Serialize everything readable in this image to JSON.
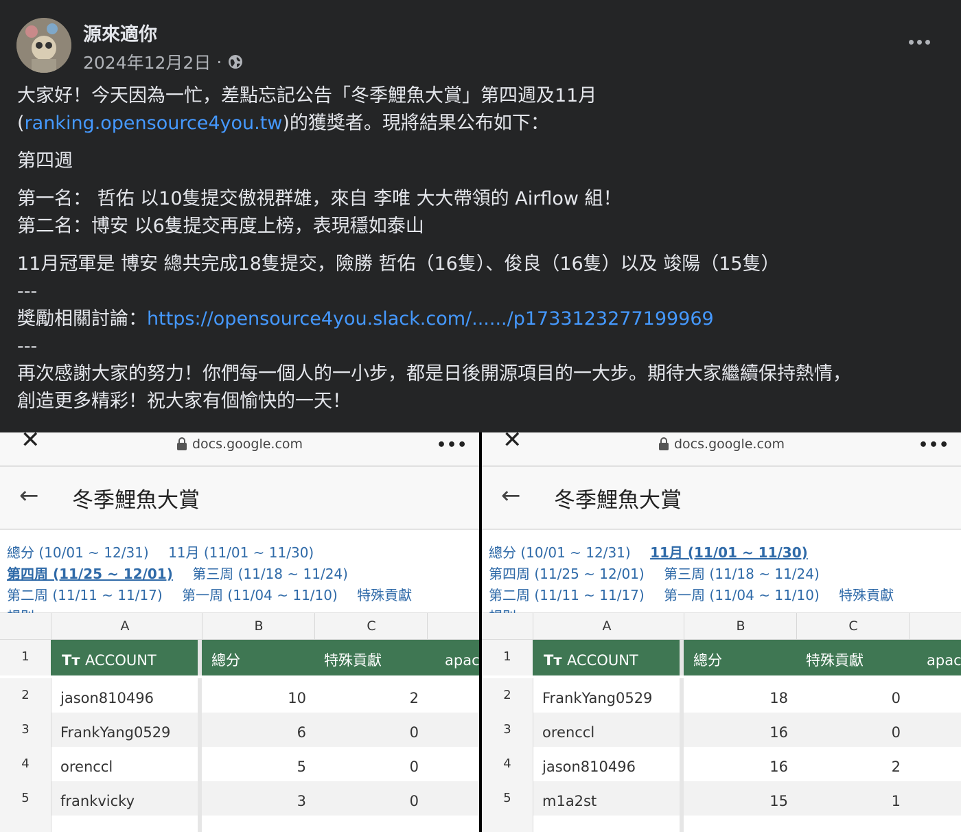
{
  "post": {
    "author": "源來適你",
    "date": "2024年12月2日",
    "date_sep": "·",
    "audience_icon": "globe-icon",
    "menu_icon": "more-horizontal-icon",
    "lines": {
      "p1a": "大家好！今天因為一忙，差點忘記公告「冬季鯉魚大賞」第四週及11月",
      "p1b_pre": "(",
      "p1b_link": "ranking.opensource4you.tw",
      "p1b_post": ")的獲獎者。現將結果公布如下：",
      "p2": "第四週",
      "p3": "第一名： 哲佑 以10隻提交傲視群雄，來自 李唯 大大帶領的 Airflow 組！",
      "p4": "第二名：博安 以6隻提交再度上榜，表現穩如泰山",
      "p5": "11月冠軍是 博安 總共完成18隻提交，險勝 哲佑（16隻）、俊良（16隻）以及 竣陽（15隻）",
      "sep1": "---",
      "p6_pre": "獎勵相關討論：",
      "p6_link": "https://opensource4you.slack.com/....../p1733123277199969",
      "sep2": "---",
      "p7": "再次感謝大家的努力！你們每一個人的一小步，都是日後開源項目的一大步。期待大家繼續保持熱情，",
      "p8": "創造更多精彩！祝大家有個愉快的一天！"
    }
  },
  "panels": [
    {
      "url": "docs.google.com",
      "title": "冬季鯉魚大賞",
      "tabs": [
        {
          "label": "總分 (10/01 ~ 12/31)",
          "active": false
        },
        {
          "label": "11月 (11/01 ~ 11/30)",
          "active": false
        },
        {
          "label": "第四周 (11/25 ~ 12/01)",
          "active": true
        },
        {
          "label": "第三周 (11/18 ~ 11/24)",
          "active": false
        },
        {
          "label": "第二周 (11/11 ~ 11/17)",
          "active": false
        },
        {
          "label": "第一周 (11/04 ~ 11/10)",
          "active": false
        },
        {
          "label": "特殊貢獻",
          "active": false
        },
        {
          "label": "規則",
          "active": false
        }
      ],
      "col_headers": [
        "A",
        "B",
        "C"
      ],
      "header": {
        "row": "1",
        "account_icon": "Tт",
        "account": "ACCOUNT",
        "total": "總分",
        "special": "特殊貢獻",
        "extra": "apacl"
      },
      "rows": [
        {
          "n": "2",
          "account": "jason810496",
          "total": "10",
          "special": "2"
        },
        {
          "n": "3",
          "account": "FrankYang0529",
          "total": "6",
          "special": "0"
        },
        {
          "n": "4",
          "account": "orenccl",
          "total": "5",
          "special": "0"
        },
        {
          "n": "5",
          "account": "frankvicky",
          "total": "3",
          "special": "0"
        }
      ]
    },
    {
      "url": "docs.google.com",
      "title": "冬季鯉魚大賞",
      "tabs": [
        {
          "label": "總分 (10/01 ~ 12/31)",
          "active": false
        },
        {
          "label": "11月 (11/01 ~ 11/30)",
          "active": true
        },
        {
          "label": "第四周 (11/25 ~ 12/01)",
          "active": false
        },
        {
          "label": "第三周 (11/18 ~ 11/24)",
          "active": false
        },
        {
          "label": "第二周 (11/11 ~ 11/17)",
          "active": false
        },
        {
          "label": "第一周 (11/04 ~ 11/10)",
          "active": false
        },
        {
          "label": "特殊貢獻",
          "active": false
        },
        {
          "label": "規則",
          "active": false
        }
      ],
      "col_headers": [
        "A",
        "B",
        "C"
      ],
      "header": {
        "row": "1",
        "account_icon": "Tт",
        "account": "ACCOUNT",
        "total": "總分",
        "special": "特殊貢獻",
        "extra": "apacl"
      },
      "rows": [
        {
          "n": "2",
          "account": "FrankYang0529",
          "total": "18",
          "special": "0"
        },
        {
          "n": "3",
          "account": "orenccl",
          "total": "16",
          "special": "0"
        },
        {
          "n": "4",
          "account": "jason810496",
          "total": "16",
          "special": "2"
        },
        {
          "n": "5",
          "account": "m1a2st",
          "total": "15",
          "special": "1"
        }
      ]
    }
  ],
  "colors": {
    "accent_link": "#4599ff",
    "sheet_header": "#3f7753",
    "tab_link": "#2f6aa8"
  }
}
